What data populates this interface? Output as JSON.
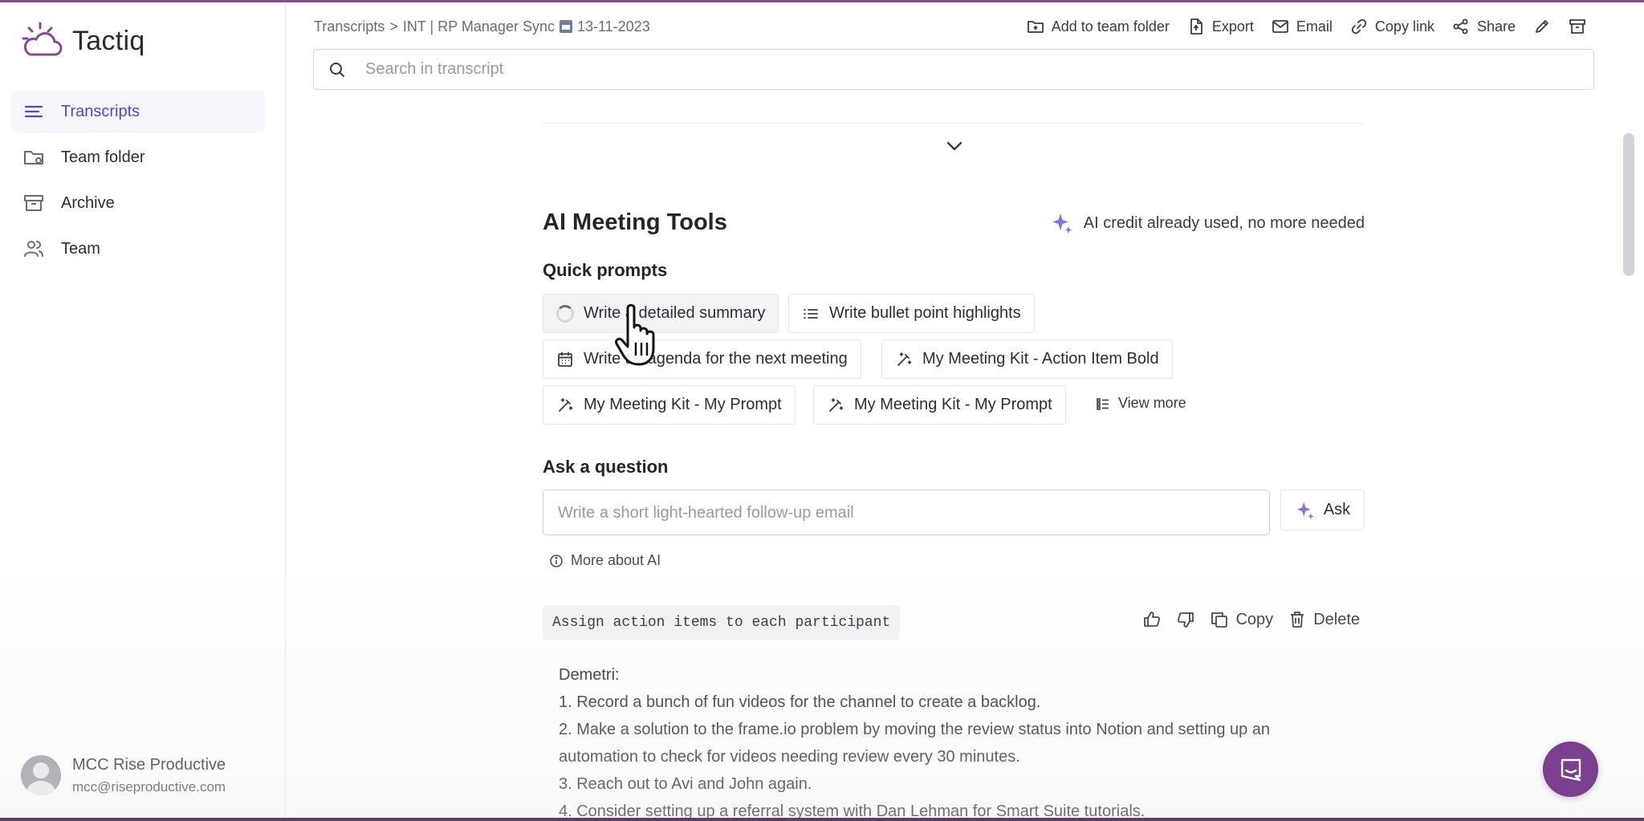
{
  "app": {
    "name": "Tactiq",
    "brand_color": "#7a3f8e",
    "accent_color": "#5b3fd6"
  },
  "sidebar": {
    "items": [
      {
        "label": "Transcripts",
        "icon": "menu-lines-icon",
        "active": true
      },
      {
        "label": "Team folder",
        "icon": "folder-icon",
        "active": false
      },
      {
        "label": "Archive",
        "icon": "archive-icon",
        "active": false
      },
      {
        "label": "Team",
        "icon": "users-icon",
        "active": false
      }
    ],
    "user": {
      "name": "MCC Rise Productive",
      "email": "mcc@riseproductive.com"
    }
  },
  "header": {
    "breadcrumb": {
      "root": "Transcripts",
      "separator": ">",
      "title": "INT | RP Manager Sync",
      "date": "13-11-2023"
    },
    "actions": {
      "add_to_team_folder": "Add to team folder",
      "export": "Export",
      "email": "Email",
      "copy_link": "Copy link",
      "share": "Share"
    },
    "search": {
      "placeholder": "Search in transcript"
    }
  },
  "ai_tools": {
    "title": "AI Meeting Tools",
    "credit_note": "AI credit already used, no more needed",
    "quick_prompts_title": "Quick prompts",
    "prompts": [
      "Write a detailed summary",
      "Write bullet point highlights",
      "Write an agenda for the next meeting",
      "My Meeting Kit - Action Item Bold",
      "My Meeting Kit - My Prompt",
      "My Meeting Kit - My Prompt"
    ],
    "view_more": "View more",
    "ask_title": "Ask a question",
    "ask_placeholder": "Write a short light-hearted follow-up email",
    "ask_button": "Ask",
    "more_about_ai": "More about AI"
  },
  "result": {
    "prompt": "Assign action items to each participant",
    "actions": {
      "copy": "Copy",
      "delete": "Delete"
    },
    "lines": [
      "Demetri:",
      "1. Record a bunch of fun videos for the channel to create a backlog.",
      "2. Make a solution to the frame.io problem by moving the review status into Notion and setting up an",
      "automation to check for videos needing review every 30 minutes.",
      "3. Reach out to Avi and John again.",
      "4. Consider setting up a referral system with Dan Lehman for Smart Suite tutorials."
    ]
  }
}
